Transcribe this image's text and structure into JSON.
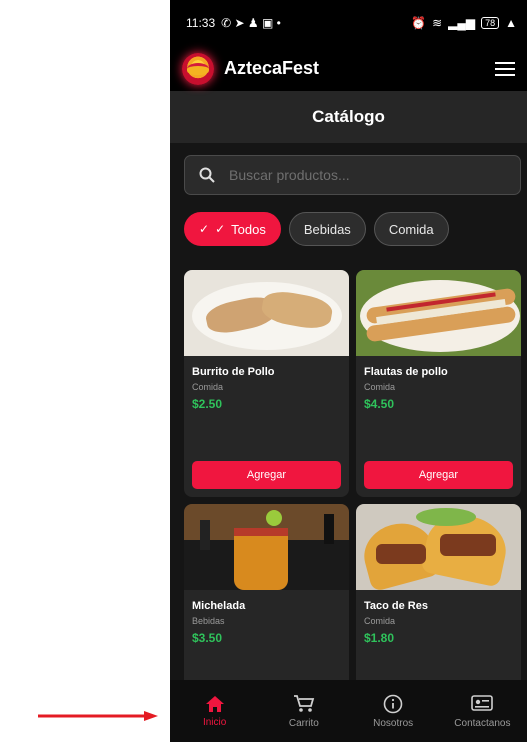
{
  "status_bar": {
    "time": "11:33",
    "battery": "78"
  },
  "app": {
    "name": "AztecaFest"
  },
  "page": {
    "title": "Catálogo"
  },
  "search": {
    "placeholder": "Buscar productos..."
  },
  "filters": [
    {
      "label": "Todos",
      "active": true
    },
    {
      "label": "Bebidas",
      "active": false
    },
    {
      "label": "Comida",
      "active": false
    }
  ],
  "products": [
    {
      "name": "Burrito de Pollo",
      "category": "Comida",
      "price": "$2.50",
      "button": "Agregar"
    },
    {
      "name": "Flautas de pollo",
      "category": "Comida",
      "price": "$4.50",
      "button": "Agregar"
    },
    {
      "name": "Michelada",
      "category": "Bebidas",
      "price": "$3.50"
    },
    {
      "name": "Taco de Res",
      "category": "Comida",
      "price": "$1.80"
    }
  ],
  "nav": [
    {
      "label": "Inicio",
      "icon": "home-icon",
      "active": true
    },
    {
      "label": "Carrito",
      "icon": "cart-icon",
      "active": false
    },
    {
      "label": "Nosotros",
      "icon": "info-icon",
      "active": false
    },
    {
      "label": "Contactanos",
      "icon": "contact-card-icon",
      "active": false
    }
  ],
  "colors": {
    "accent": "#f0163f",
    "price": "#2fc25b",
    "background": "#151515"
  }
}
